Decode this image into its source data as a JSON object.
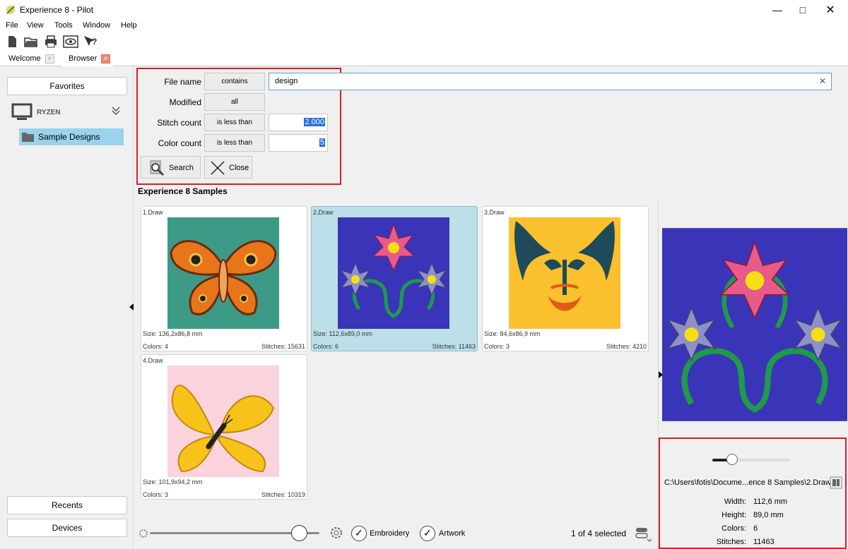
{
  "window": {
    "title": "Experience 8 - Pilot"
  },
  "menu": [
    "File",
    "View",
    "Tools",
    "Window",
    "Help"
  ],
  "toolbar_icons": [
    "new-file-icon",
    "open-folder-icon",
    "print-icon",
    "preview-eye-icon",
    "help-pointer-icon"
  ],
  "tabs": [
    {
      "label": "Welcome"
    },
    {
      "label": "Browser"
    }
  ],
  "sidebar": {
    "favorites": "Favorites",
    "computer": "RYZEN",
    "folder": "Sample Designs",
    "recents": "Recents",
    "devices": "Devices"
  },
  "search": {
    "file_name_label": "File name",
    "file_name_op": "contains",
    "file_name_value": "design",
    "modified_label": "Modified",
    "modified_op": "all",
    "stitch_label": "Stitch count",
    "stitch_op": "is less than",
    "stitch_value": "2.000",
    "color_label": "Color count",
    "color_op": "is less than",
    "color_value": "5",
    "search_btn": "Search",
    "close_btn": "Close"
  },
  "section_title": "Experience 8 Samples",
  "designs": [
    {
      "name": "1.Draw",
      "size": "Size: 136,2x86,8 mm",
      "colors": "Colors: 4",
      "stitches": "Stitches: 15631",
      "bg": "#3d9a87",
      "selected": false
    },
    {
      "name": "2.Draw",
      "size": "Size: 112,6x89,0 mm",
      "colors": "Colors: 6",
      "stitches": "Stitches: 11463",
      "bg": "#3a35b8",
      "selected": true
    },
    {
      "name": "3.Draw",
      "size": "Size: 84,6x86,9 mm",
      "colors": "Colors: 3",
      "stitches": "Stitches: 4210",
      "bg": "#fbc02d",
      "selected": false
    },
    {
      "name": "4.Draw",
      "size": "Size: 101,9x94,2 mm",
      "colors": "Colors: 3",
      "stitches": "Stitches: 10319",
      "bg": "#fbd3dc",
      "selected": false
    }
  ],
  "bottom": {
    "embroidery": "Embroidery",
    "artwork": "Artwork",
    "selected_count": "1 of 4 selected",
    "zoom_level": 0.88
  },
  "preview": {
    "path": "C:\\Users\\fotis\\Docume...ence 8 Samples\\2.Draw",
    "width_label": "Width:",
    "width_value": "112,6 mm",
    "height_label": "Height:",
    "height_value": "89,0 mm",
    "colors_label": "Colors:",
    "colors_value": "6",
    "stitches_label": "Stitches:",
    "stitches_value": "11463",
    "slider_level": 0.25
  }
}
